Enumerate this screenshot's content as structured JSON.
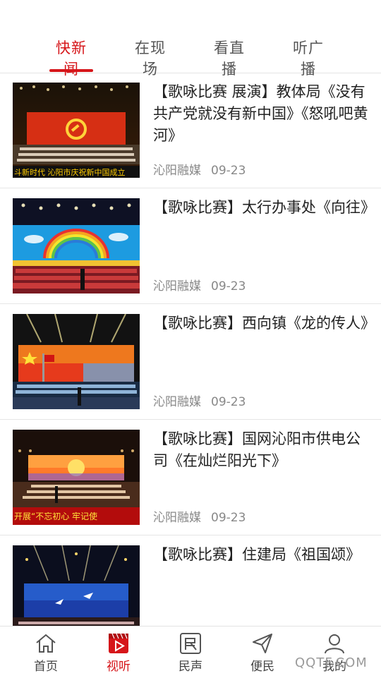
{
  "tabs": [
    {
      "label": "快新闻",
      "active": true
    },
    {
      "label": "在现场",
      "active": false
    },
    {
      "label": "看直播",
      "active": false
    },
    {
      "label": "听广播",
      "active": false
    }
  ],
  "articles": [
    {
      "title": "【歌咏比赛 展演】教体局《没有共产党就没有新中国》《怒吼吧黄河》",
      "source": "沁阳融媒",
      "date": "09-23",
      "thumb_banner": "斗新时代  沁阳市庆祝新中国成立"
    },
    {
      "title": "【歌咏比赛】太行办事处《向往》",
      "source": "沁阳融媒",
      "date": "09-23"
    },
    {
      "title": "【歌咏比赛】西向镇《龙的传人》",
      "source": "沁阳融媒",
      "date": "09-23"
    },
    {
      "title": "【歌咏比赛】国网沁阳市供电公司《在灿烂阳光下》",
      "source": "沁阳融媒",
      "date": "09-23",
      "thumb_banner": "开展“不忘初心 牢记使"
    },
    {
      "title": "【歌咏比赛】住建局《祖国颂》",
      "source": "",
      "date": ""
    }
  ],
  "nav": [
    {
      "label": "首页",
      "icon": "home-icon",
      "active": false
    },
    {
      "label": "视听",
      "icon": "video-play-icon",
      "active": true
    },
    {
      "label": "民声",
      "icon": "min-badge-icon",
      "active": false
    },
    {
      "label": "便民",
      "icon": "send-icon",
      "active": false
    },
    {
      "label": "我的",
      "icon": "user-icon",
      "active": false
    }
  ],
  "watermark": "QQTF.COM",
  "colors": {
    "accent": "#d6161a",
    "meta": "#888888",
    "divider": "#e6e6e6"
  }
}
